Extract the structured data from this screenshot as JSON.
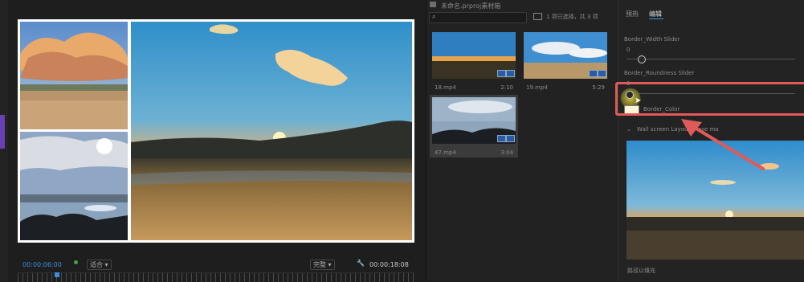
{
  "monitor": {
    "timecode": "00:00:06:00",
    "playback_resolution": "适合",
    "quality": "完整",
    "duration": "00:00:18:08"
  },
  "project": {
    "title": "未命名.prproj素材箱",
    "selection_info": "1 项已选择，共 3 项",
    "items": [
      {
        "name": "18.mp4",
        "duration": "2:10"
      },
      {
        "name": "19.mp4",
        "duration": "5:29"
      },
      {
        "name": "47.mp4",
        "duration": "3:04"
      }
    ]
  },
  "effects": {
    "tabs": [
      "预热",
      "编辑"
    ],
    "active_tab": "编辑",
    "border_width_label": "Border_Width Slider",
    "border_width_value": "0",
    "border_roundness_label": "Border_Roundness Slider",
    "border_roundness_value": "0",
    "border_color_label": "Border_Color",
    "border_color_value": "#fff4d6",
    "section_label": "Wall screen Layout_P ase ma",
    "footer_label": "路径以填充"
  },
  "colors": {
    "highlight": "#e05a5a",
    "timecode": "#3a8ee6",
    "accent_bar": "#6a3fb5"
  }
}
